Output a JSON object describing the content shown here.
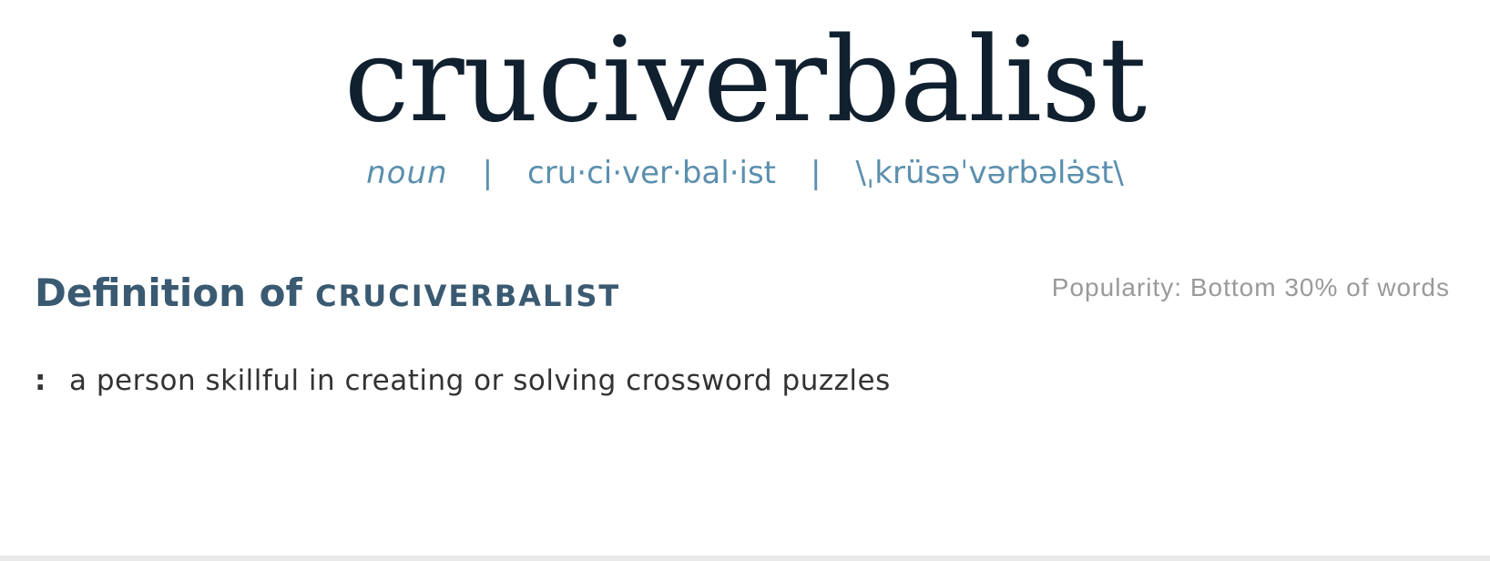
{
  "entry": {
    "headword": "cruciverbalist",
    "part_of_speech": "noun",
    "separator": "|",
    "syllables": "cru·ci·ver·bal·ist",
    "pronunciation": "\\ˌkrüsəˈvərbələ̇st\\"
  },
  "definition_section": {
    "heading_lead": "Definition of",
    "heading_word": "CRUCIVERBALIST",
    "popularity": "Popularity: Bottom 30% of words",
    "senses": [
      {
        "marker": ":",
        "text": "a person skillful in creating or solving crossword puzzles"
      }
    ]
  },
  "colors": {
    "headword": "#10202f",
    "pronunciation": "#5b8fae",
    "heading": "#3a5a72",
    "popularity": "#9a9a9a",
    "body_text": "#333333"
  }
}
